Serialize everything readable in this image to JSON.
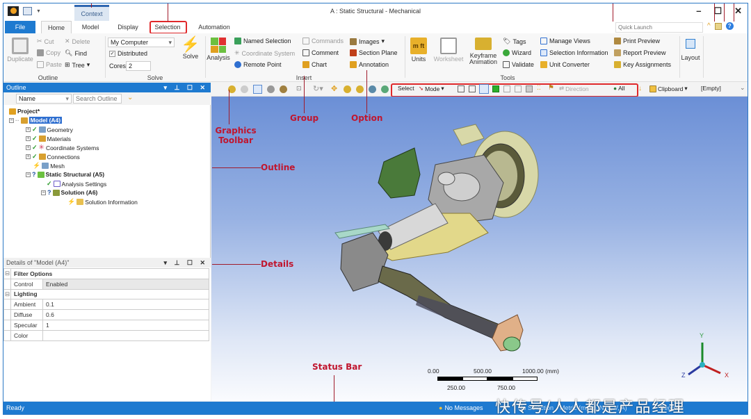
{
  "window": {
    "title": "A : Static Structural - Mechanical",
    "minimize": "–",
    "maximize": "☐",
    "close": "✕"
  },
  "context_tab": "Context",
  "tabs": [
    "File",
    "Home",
    "Model",
    "Display",
    "Selection",
    "Automation"
  ],
  "active_tab": "Home",
  "highlighted_tab": "Selection",
  "quick_launch": {
    "placeholder": "Quick Launch"
  },
  "ribbon": {
    "outline_group": {
      "label": "Outline",
      "duplicate": "Duplicate",
      "cut": "Cut",
      "copy": "Copy",
      "paste": "Paste",
      "delete": "Delete",
      "find": "Find",
      "tree": "Tree"
    },
    "solve_group": {
      "label": "Solve",
      "machine": "My Computer",
      "distributed": "Distributed",
      "cores_label": "Cores",
      "cores_value": "2",
      "solve": "Solve"
    },
    "insert_group": {
      "label": "Insert",
      "analysis": "Analysis",
      "named_selection": "Named Selection",
      "coordinate_system": "Coordinate System",
      "remote_point": "Remote Point",
      "commands": "Commands",
      "comment": "Comment",
      "chart": "Chart",
      "images": "Images",
      "section_plane": "Section Plane",
      "annotation": "Annotation"
    },
    "tools_group": {
      "label": "Tools",
      "units": "Units",
      "worksheet": "Worksheet",
      "keyframe": "Keyframe Animation",
      "tags": "Tags",
      "wizard": "Wizard",
      "validate": "Validate",
      "manage_views": "Manage Views",
      "selection_information": "Selection Information",
      "unit_converter": "Unit Converter",
      "print_preview": "Print Preview",
      "report_preview": "Report Preview",
      "key_assignments": "Key Assignments"
    },
    "layout_group": {
      "layout": "Layout"
    }
  },
  "outline": {
    "title": "Outline",
    "filter_name": "Name",
    "search_placeholder": "Search Outline",
    "tree": [
      {
        "label": "Project*",
        "bold": true
      },
      {
        "label": "Model (A4)",
        "bold": true,
        "selected": true
      },
      {
        "label": "Geometry",
        "status": "ok"
      },
      {
        "label": "Materials",
        "status": "ok"
      },
      {
        "label": "Coordinate Systems",
        "status": "ok"
      },
      {
        "label": "Connections",
        "status": "ok"
      },
      {
        "label": "Mesh",
        "status": "lightning"
      },
      {
        "label": "Static Structural (A5)",
        "bold": true,
        "status": "question"
      },
      {
        "label": "Analysis Settings",
        "status": "ok"
      },
      {
        "label": "Solution (A6)",
        "bold": true,
        "status": "question"
      },
      {
        "label": "Solution Information",
        "status": "lightning"
      }
    ]
  },
  "details": {
    "title": "Details of \"Model (A4)\"",
    "sections": [
      {
        "name": "Filter Options",
        "rows": [
          {
            "key": "Control",
            "value": "Enabled"
          }
        ]
      },
      {
        "name": "Lighting",
        "rows": [
          {
            "key": "Ambient",
            "value": "0.1"
          },
          {
            "key": "Diffuse",
            "value": "0.6"
          },
          {
            "key": "Specular",
            "value": "1"
          },
          {
            "key": "Color",
            "value": ""
          }
        ]
      }
    ]
  },
  "graphics_toolbar": {
    "select": "Select",
    "mode": "Mode",
    "direction": "Direction",
    "all": "All",
    "clipboard": "Clipboard",
    "clipboard_state": "[Empty]"
  },
  "scale_bar": {
    "ticks_top": [
      "0.00",
      "500.00",
      "1000.00 (mm)"
    ],
    "ticks_bottom": [
      "250.00",
      "750.00"
    ]
  },
  "triad": {
    "x": "X",
    "y": "Y",
    "z": "Z"
  },
  "annotations": [
    "Graphics Toolbar",
    "Group",
    "Option",
    "Outline",
    "Details",
    "Status Bar"
  ],
  "status_bar": {
    "left": "Ready",
    "messages": "No Messages",
    "selection": "No Selection",
    "units": "Metric (m, kg, N, s, V, A)",
    "angle": "Degrees",
    "rad": "rad/s",
    "temp": "Celsius"
  },
  "watermark": "快传号/人人都是产品经理",
  "colors": {
    "accent": "#1e7ad0",
    "highlight": "#e0282a",
    "annotation": "#c0162f"
  }
}
